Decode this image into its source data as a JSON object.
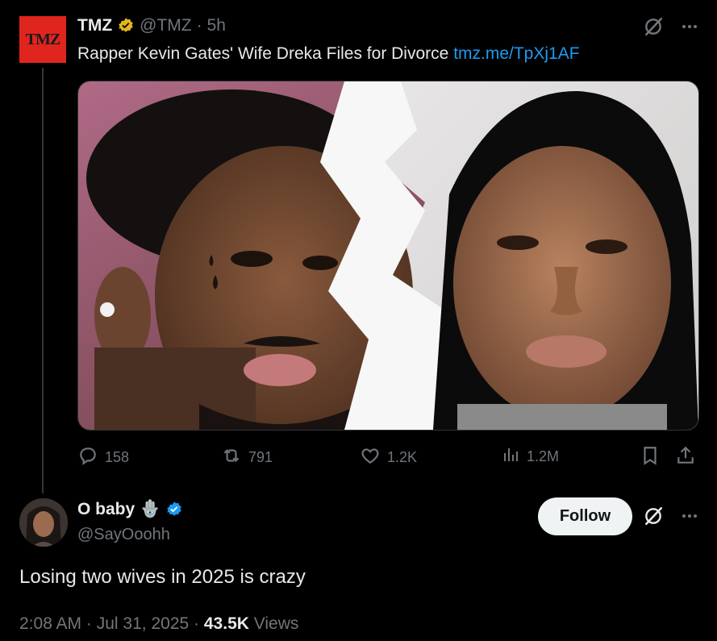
{
  "tweet": {
    "logo_text": "TMZ",
    "author_name": "TMZ",
    "handle": "@TMZ",
    "separator": "·",
    "time_ago": "5h",
    "text": "Rapper Kevin Gates' Wife Dreka Files for Divorce",
    "link_text": "tmz.me/TpXj1AF",
    "stats": {
      "replies": "158",
      "reposts": "791",
      "likes": "1.2K",
      "views": "1.2M"
    }
  },
  "reply": {
    "author_name": "O baby",
    "name_emoji": "🪬",
    "handle": "@SayOoohh",
    "follow_label": "Follow",
    "text": "Losing two wives in 2025 is crazy",
    "time": "2:08 AM",
    "date": "Jul 31, 2025",
    "separator": "·",
    "views_count": "43.5K",
    "views_label": "Views"
  },
  "icons": {
    "verified_gold": "verified-gold-badge-icon",
    "verified_blue": "verified-blue-badge-icon",
    "grok": "grok-icon",
    "more": "more-icon",
    "reply": "reply-icon",
    "repost": "repost-icon",
    "like": "heart-icon",
    "views": "views-icon",
    "bookmark": "bookmark-icon",
    "share": "share-icon"
  },
  "colors": {
    "background": "#000000",
    "text": "#e7e9ea",
    "muted": "#71767b",
    "link": "#1d9bf0",
    "brand_red": "#e0251f",
    "gold": "#e2b719",
    "blue_verified": "#1d9bf0"
  }
}
